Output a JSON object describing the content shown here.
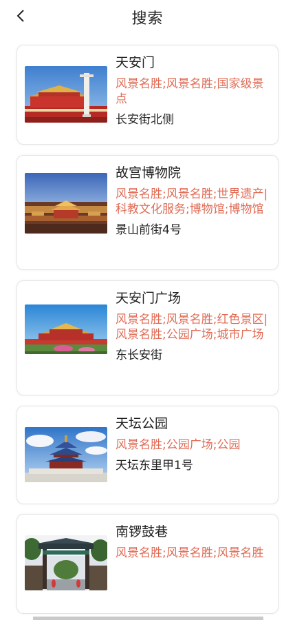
{
  "header": {
    "title": "搜索",
    "back_icon": "chevron-left-icon"
  },
  "results": [
    {
      "name": "天安门",
      "tags": "风景名胜;风景名胜;国家级景点",
      "address": "长安街北侧",
      "image": "tiananmen-gate-photo"
    },
    {
      "name": "故宫博物院",
      "tags": "风景名胜;风景名胜;世界遗产|科教文化服务;博物馆;博物馆",
      "address": "景山前街4号",
      "image": "forbidden-city-photo"
    },
    {
      "name": "天安门广场",
      "tags": "风景名胜;风景名胜;红色景区|风景名胜;公园广场;城市广场",
      "address": "东长安街",
      "image": "tiananmen-square-photo"
    },
    {
      "name": "天坛公园",
      "tags": "风景名胜;公园广场;公园",
      "address": "天坛东里甲1号",
      "image": "temple-of-heaven-photo"
    },
    {
      "name": "南锣鼓巷",
      "tags": "风景名胜;风景名胜;风景名胜",
      "address": "",
      "image": "nanluoguxiang-gate-photo"
    }
  ],
  "colors": {
    "tag_text": "#e06b55",
    "card_border": "#e4e4e4",
    "text": "#222222"
  }
}
